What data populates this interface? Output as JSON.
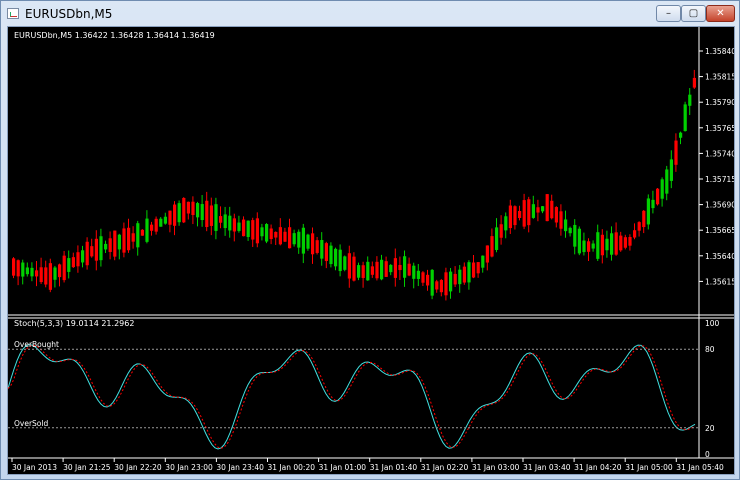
{
  "window": {
    "title": "EURUSDbn,M5"
  },
  "controls": {
    "minimize": "–",
    "maximize": "▢",
    "close": "✕"
  },
  "chart": {
    "symbol_info": "EURUSDbn,M5  1.36422 1.36428 1.36414 1.36419",
    "price_axis": [
      "1.35840",
      "1.35815",
      "1.35790",
      "1.35765",
      "1.35740",
      "1.35715",
      "1.35690",
      "1.35665",
      "1.35640",
      "1.35615"
    ],
    "time_axis": [
      "30 Jan 2013",
      "30 Jan 21:25",
      "30 Jan 22:20",
      "30 Jan 23:00",
      "30 Jan 23:40",
      "31 Jan 00:20",
      "31 Jan 01:00",
      "31 Jan 01:40",
      "31 Jan 02:20",
      "31 Jan 03:00",
      "31 Jan 03:40",
      "31 Jan 04:20",
      "31 Jan 05:00",
      "31 Jan 05:40"
    ],
    "indicator": {
      "label": "Stoch(5,3,3) 19.0114 21.2962",
      "overbought_label": "OverBought",
      "oversold_label": "OverSold",
      "levels": [
        "100",
        "80",
        "20",
        "0"
      ],
      "overbought_level": 80,
      "oversold_level": 20
    },
    "colors": {
      "background": "#000000",
      "bull": "#00d000",
      "bear": "#ff0000",
      "main_line": "#40e0e0",
      "signal_line": "#ff0000",
      "level_line": "#9a9a9a",
      "text": "#ffffff"
    }
  }
}
